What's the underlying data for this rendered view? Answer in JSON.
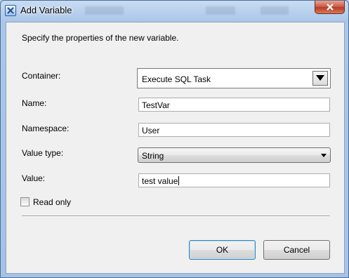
{
  "window": {
    "title": "Add Variable",
    "background_hint": [
      "Variable Name",
      "Direction",
      "Data Type"
    ]
  },
  "dialog": {
    "intro": "Specify the properties of the new variable.",
    "container": {
      "label": "Container:",
      "value": "Execute SQL Task"
    },
    "name": {
      "label": "Name:",
      "value": "TestVar"
    },
    "namespace": {
      "label": "Namespace:",
      "value": "User"
    },
    "value_type": {
      "label": "Value type:",
      "value": "String"
    },
    "value": {
      "label": "Value:",
      "value": "test value"
    },
    "read_only": {
      "label": "Read only",
      "checked": false
    }
  },
  "buttons": {
    "ok": "OK",
    "cancel": "Cancel"
  },
  "icons": {
    "app": "variable-icon",
    "close": "close-icon",
    "dropdown": "chevron-down-icon"
  },
  "colors": {
    "close_button": "#c9553e",
    "client_bg": "#f0f0f0",
    "frame": "#a6c2e6"
  }
}
